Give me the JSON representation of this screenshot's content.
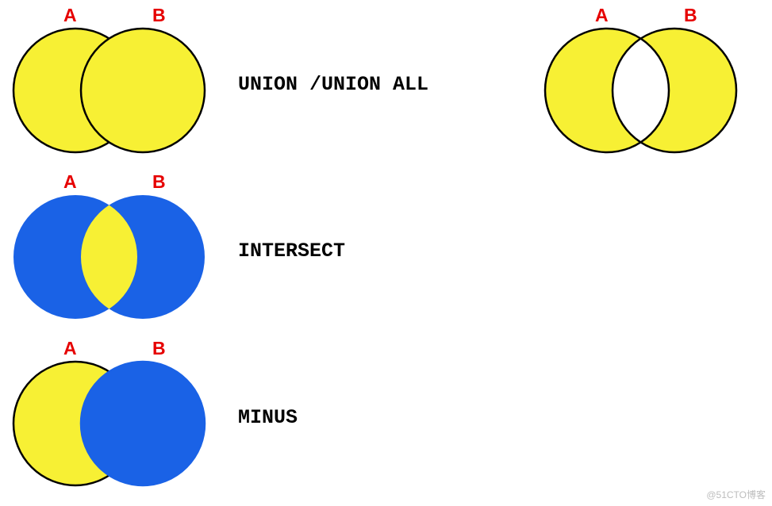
{
  "diagrams": {
    "union": {
      "setA": "A",
      "setB": "B",
      "operation": "UNION /UNION ALL",
      "colors": {
        "a": "#f7f034",
        "b": "#f7f034",
        "aStroke": "#000000",
        "bStroke": "#000000"
      }
    },
    "intersect": {
      "setA": "A",
      "setB": "B",
      "operation": "INTERSECT",
      "colors": {
        "a": "#1a62e6",
        "b": "#1a62e6",
        "intersection": "#f7f034",
        "aStroke": "#1a62e6",
        "bStroke": "#1a62e6"
      }
    },
    "minus": {
      "setA": "A",
      "setB": "B",
      "operation": "MINUS",
      "colors": {
        "a": "#f7f034",
        "b": "#1a62e6",
        "aStroke": "#000000",
        "bStroke": "#1a62e6"
      }
    },
    "result": {
      "setA": "A",
      "setB": "B",
      "colors": {
        "a": "#f7f034",
        "b": "#f7f034",
        "intersection": "#ffffff",
        "aStroke": "#000000",
        "bStroke": "#000000"
      }
    }
  },
  "watermark": "@51CTO博客"
}
